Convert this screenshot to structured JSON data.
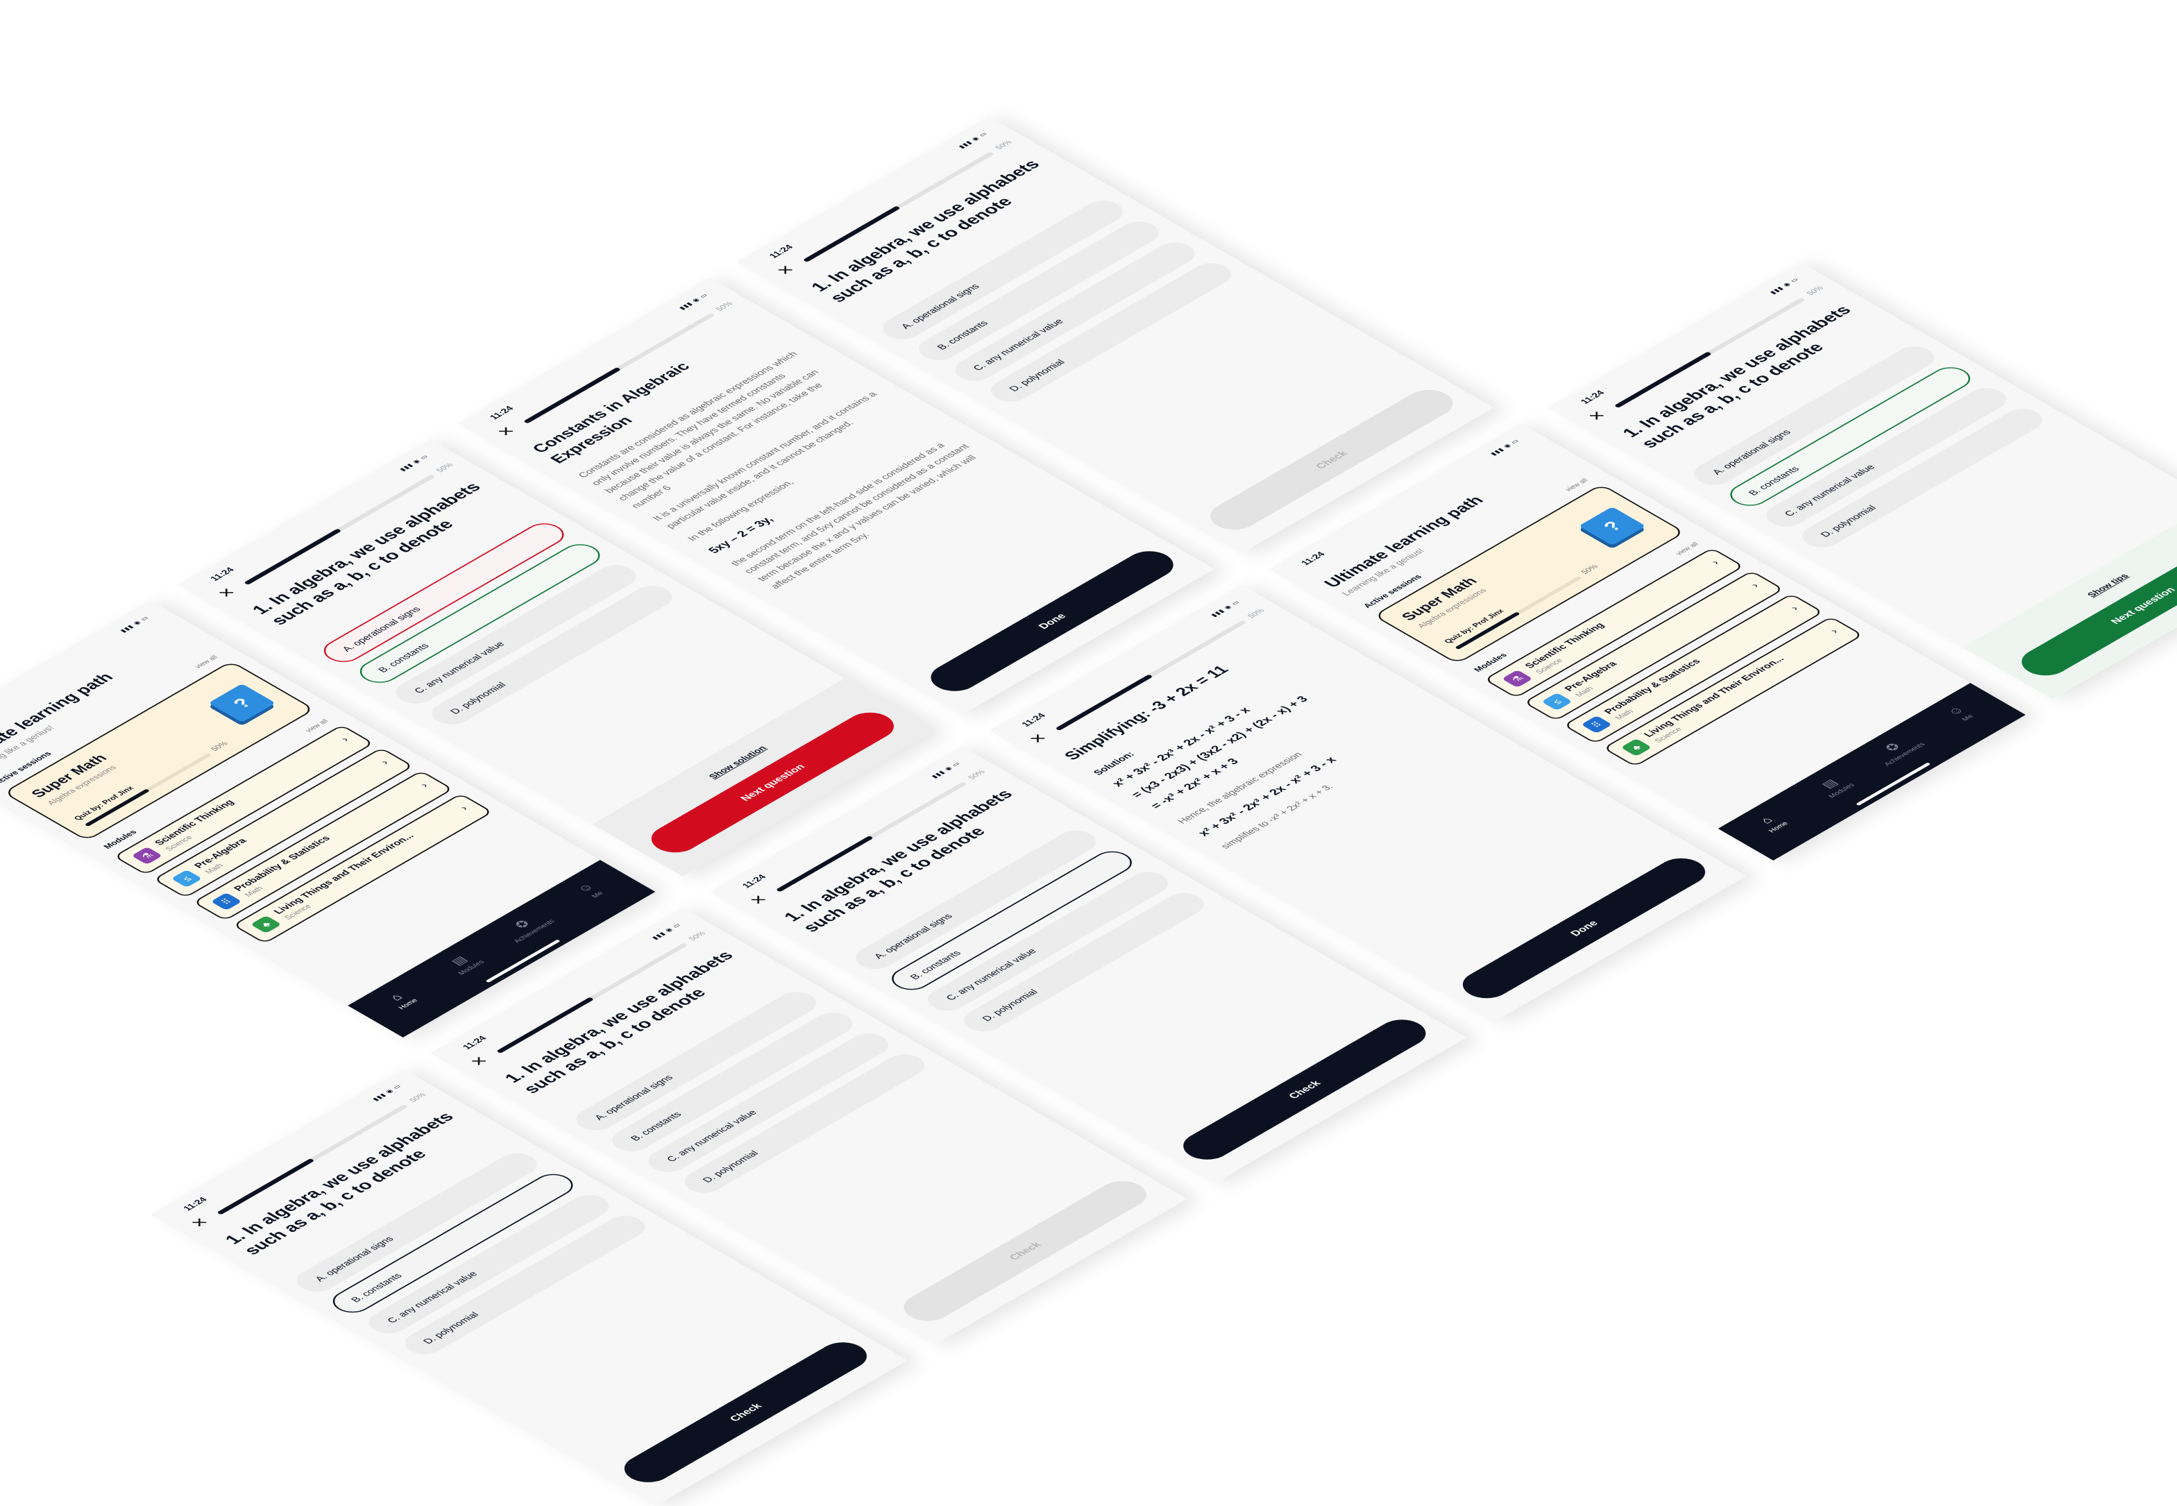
{
  "status": {
    "time": "11:24",
    "signal": "▮▮▮ ◉ ▭"
  },
  "quiz": {
    "close": "✕",
    "progress_label": "50%",
    "progress_fraction": 0.5,
    "question": "1. In algebra, we use alphabets such as a, b, c to denote",
    "options": {
      "a": "A. operational signs",
      "b": "B. constants",
      "c": "C. any numerical value",
      "d": "D. polynomial"
    },
    "check": "Check",
    "next": "Next question",
    "show_solution": "Show solution",
    "show_tips": "Show tips",
    "done": "Done"
  },
  "explain": {
    "title": "Constants in Algebraic Expression",
    "p1": "Constants are considered as algebraic expressions which only involve numbers. They have termed constants because their value is always the same. No variable can change the value of a constant. For instance, take the number 6",
    "p2": "It is a universally known constant number, and it contains a particular value inside, and it cannot be changed.",
    "p3": "In the following expression,",
    "eq": "5xy – 2 = 3y,",
    "p4": "the second term on the left-hand side is considered as a constant term, and 5xy cannot be considered as a constant term because the x and y values can be varied, which will affect the entire term 5xy."
  },
  "simplify": {
    "title": "Simplifying: -3 + 2x = 11",
    "solution_label": "Solution:",
    "lines": [
      "x² + 3x² - 2x³ + 2x - x² + 3 - x",
      "= (x3 - 2x3) + (3x2 - x2) + (2x - x) + 3",
      "= -x³ + 2x² + x + 3"
    ],
    "note": "Hence, the algebraic expression",
    "note2": "x² + 3x² - 2x³ + 2x - x² + 3 - x",
    "note3": "simplifies to -x³ + 2x² + x + 3."
  },
  "home": {
    "title": "Ultimate learning path",
    "subtitle": "Learning like a genius!",
    "active_label": "Active sessions",
    "view_all": "view all",
    "card": {
      "title": "Super Math",
      "sub": "Algebra expressions",
      "quiz": "Quiz by: Prof Jinx",
      "pct": "50%",
      "icon": "?"
    },
    "modules_label": "Modules",
    "modules": [
      {
        "name": "Scientific Thinking",
        "sub": "Science",
        "icon": "⚗",
        "color": "#8e44ad"
      },
      {
        "name": "Pre-Algebra",
        "sub": "Math",
        "icon": "≤",
        "color": "#3aa0e8"
      },
      {
        "name": "Probability & Statistics",
        "sub": "Math",
        "icon": "⠿",
        "color": "#1f6fd0"
      },
      {
        "name": "Living Things and Their Environ...",
        "sub": "Science",
        "icon": "♣",
        "color": "#2b9a4a"
      }
    ],
    "tabs": [
      {
        "label": "Home",
        "icon": "⌂"
      },
      {
        "label": "Modules",
        "icon": "▤"
      },
      {
        "label": "Achievements",
        "icon": "✪"
      },
      {
        "label": "Me",
        "icon": "☺"
      }
    ]
  },
  "colors": {
    "primary": "#0b1120",
    "correct": "#127a3b",
    "wrong": "#d30b1f",
    "card": "#fdf3dc"
  }
}
